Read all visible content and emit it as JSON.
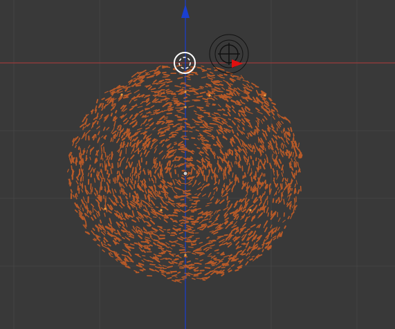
{
  "viewport": {
    "background_color": "#393939",
    "grid_color": "#444444",
    "x_axis_color": "#b23a3a",
    "z_axis_color": "#1a3fd0",
    "particle_color": "#b85a28",
    "vertex_color": "#f0a040",
    "selection_color": "#ffffff",
    "cursor_3d_color": "#111111",
    "arrow_color": "#e01010"
  },
  "icons": {
    "z_axis_arrow": "arrow-up-icon",
    "object_origin": "origin-dot-icon",
    "cursor_3d": "3d-cursor-icon",
    "manipulator": "translate-manipulator-icon",
    "lamp_or_camera_handle": "selection-circle-icon"
  }
}
